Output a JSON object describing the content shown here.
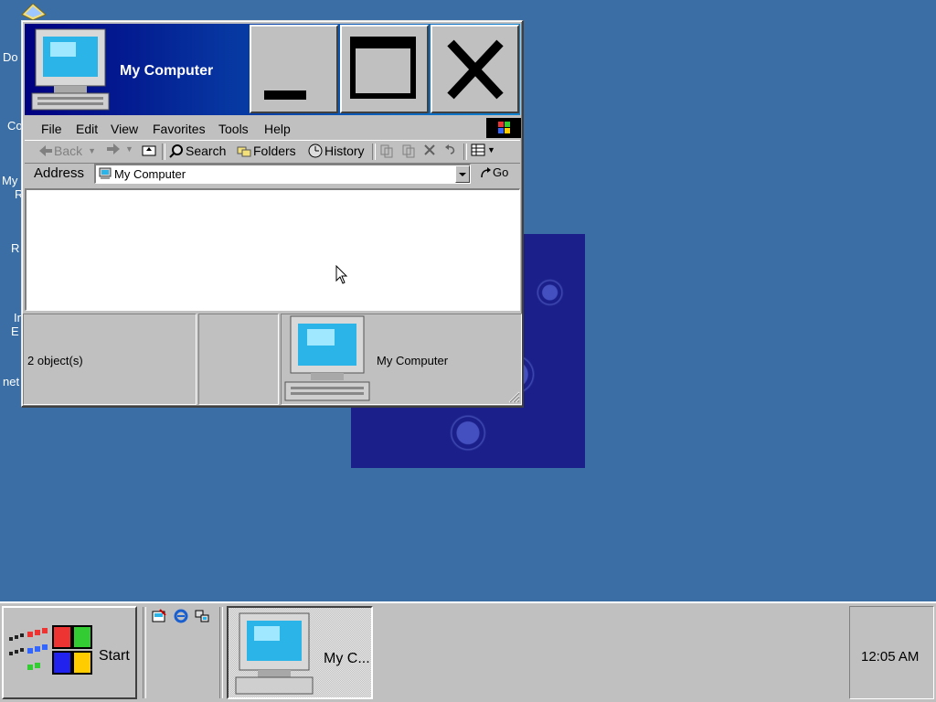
{
  "desktop": {
    "icon_labels": [
      "Do",
      "Co",
      "My",
      "R",
      "R",
      "In",
      "E",
      "net"
    ]
  },
  "window": {
    "title": "My Computer",
    "menu": [
      "File",
      "Edit",
      "View",
      "Favorites",
      "Tools",
      "Help"
    ],
    "toolbar": {
      "back": "Back",
      "search": "Search",
      "folders": "Folders",
      "history": "History"
    },
    "address": {
      "label": "Address",
      "value": "My Computer",
      "go": "Go"
    },
    "status": {
      "objects": "2 object(s)",
      "location": "My Computer"
    }
  },
  "taskbar": {
    "start_label": "Start",
    "task_label": "My C...",
    "clock": "12:05 AM"
  },
  "icons": {
    "title": "my-computer-icon",
    "minimize": "minimize-icon",
    "maximize": "maximize-icon",
    "close": "close-icon",
    "windows_logo": "windows-logo-icon"
  },
  "colors": {
    "desktop": "#3a6ea5",
    "title_start": "#000080",
    "title_end": "#1084d0",
    "face": "#c0c0c0"
  }
}
